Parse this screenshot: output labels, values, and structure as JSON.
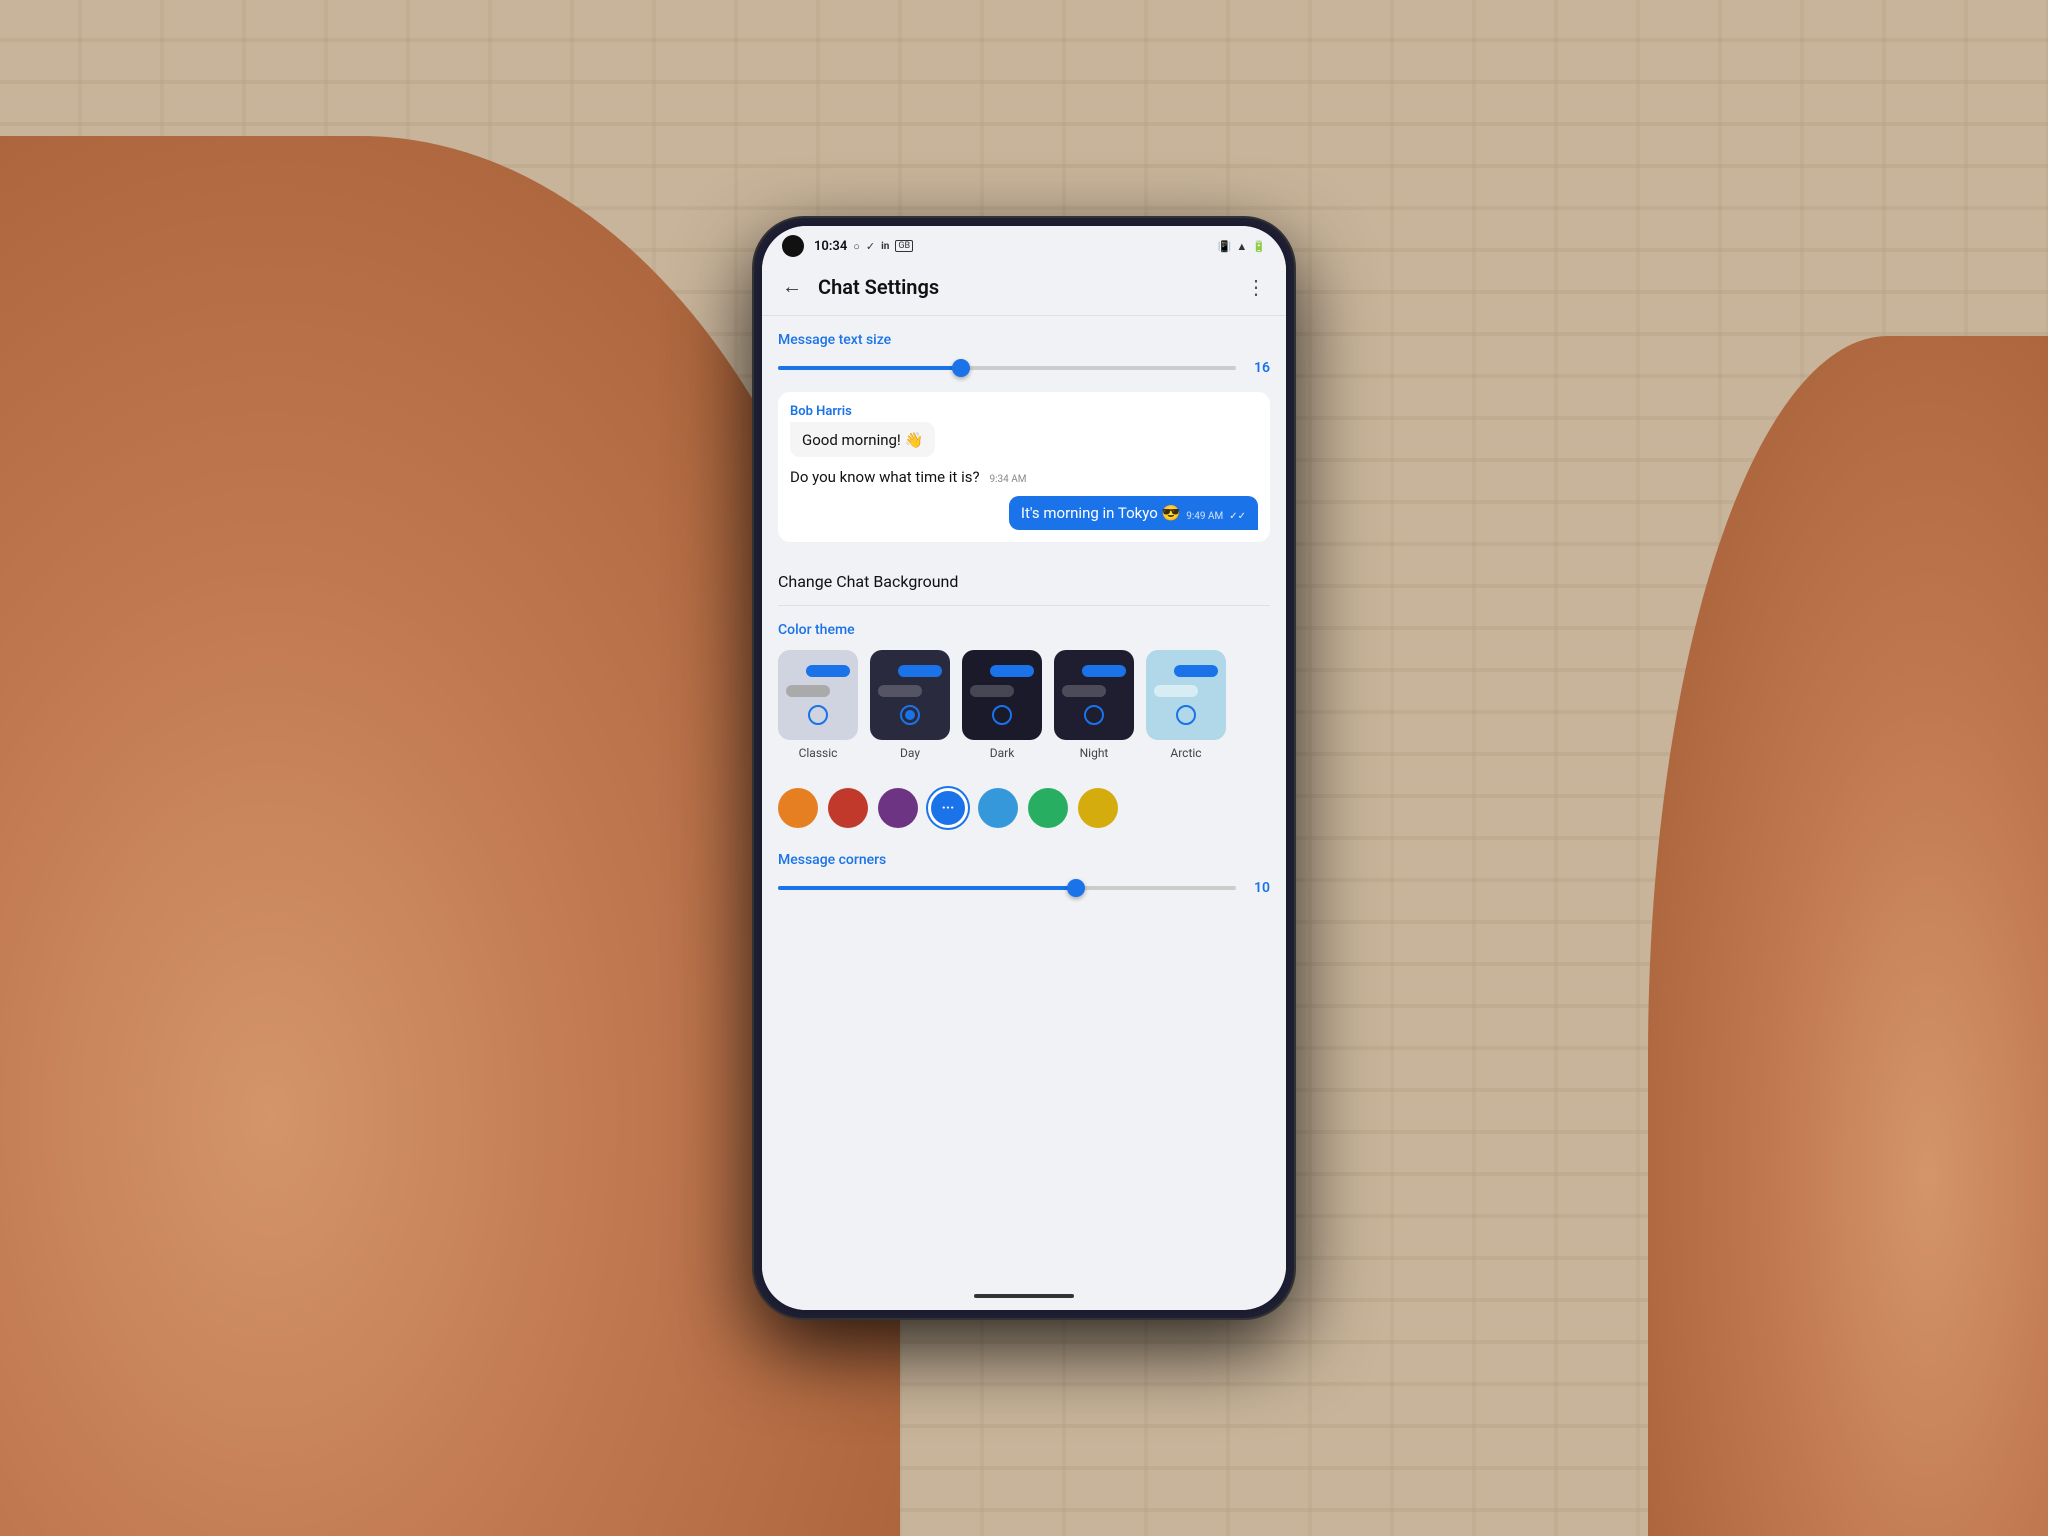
{
  "status_bar": {
    "time": "10:34",
    "icons": [
      "○",
      "✓",
      "in",
      "GB",
      "🔔",
      "WiFi",
      "🔋"
    ]
  },
  "app_bar": {
    "back_label": "←",
    "title": "Chat Settings",
    "more_label": "⋮"
  },
  "message_text_size": {
    "label": "Message text size",
    "value": "16",
    "slider_percent": 40
  },
  "chat_preview": {
    "sender": "Bob Harris",
    "received_message": "Good morning! 👋",
    "received_plain": "Do you know what time it is?",
    "received_time": "9:34 AM",
    "sent_message": "It's morning in Tokyo 😎",
    "sent_time": "9:49 AM",
    "sent_check": "✓✓"
  },
  "change_bg": {
    "label": "Change Chat Background"
  },
  "color_theme": {
    "label": "Color theme",
    "themes": [
      {
        "id": "classic",
        "name": "Classic",
        "selected": false
      },
      {
        "id": "day",
        "name": "Day",
        "selected": true
      },
      {
        "id": "dark",
        "name": "Dark",
        "selected": false
      },
      {
        "id": "night",
        "name": "Night",
        "selected": false
      },
      {
        "id": "arctic",
        "name": "Arctic",
        "selected": false
      }
    ]
  },
  "color_dots": [
    {
      "color": "#e67e22",
      "selected": false
    },
    {
      "color": "#c0392b",
      "selected": false
    },
    {
      "color": "#6c3483",
      "selected": false
    },
    {
      "color": "#1a73e8",
      "selected": true,
      "icon": "···"
    },
    {
      "color": "#3498db",
      "selected": false
    },
    {
      "color": "#27ae60",
      "selected": false
    },
    {
      "color": "#d4ac0d",
      "selected": false
    }
  ],
  "message_corners": {
    "label": "Message corners",
    "value": "10",
    "slider_percent": 65
  }
}
